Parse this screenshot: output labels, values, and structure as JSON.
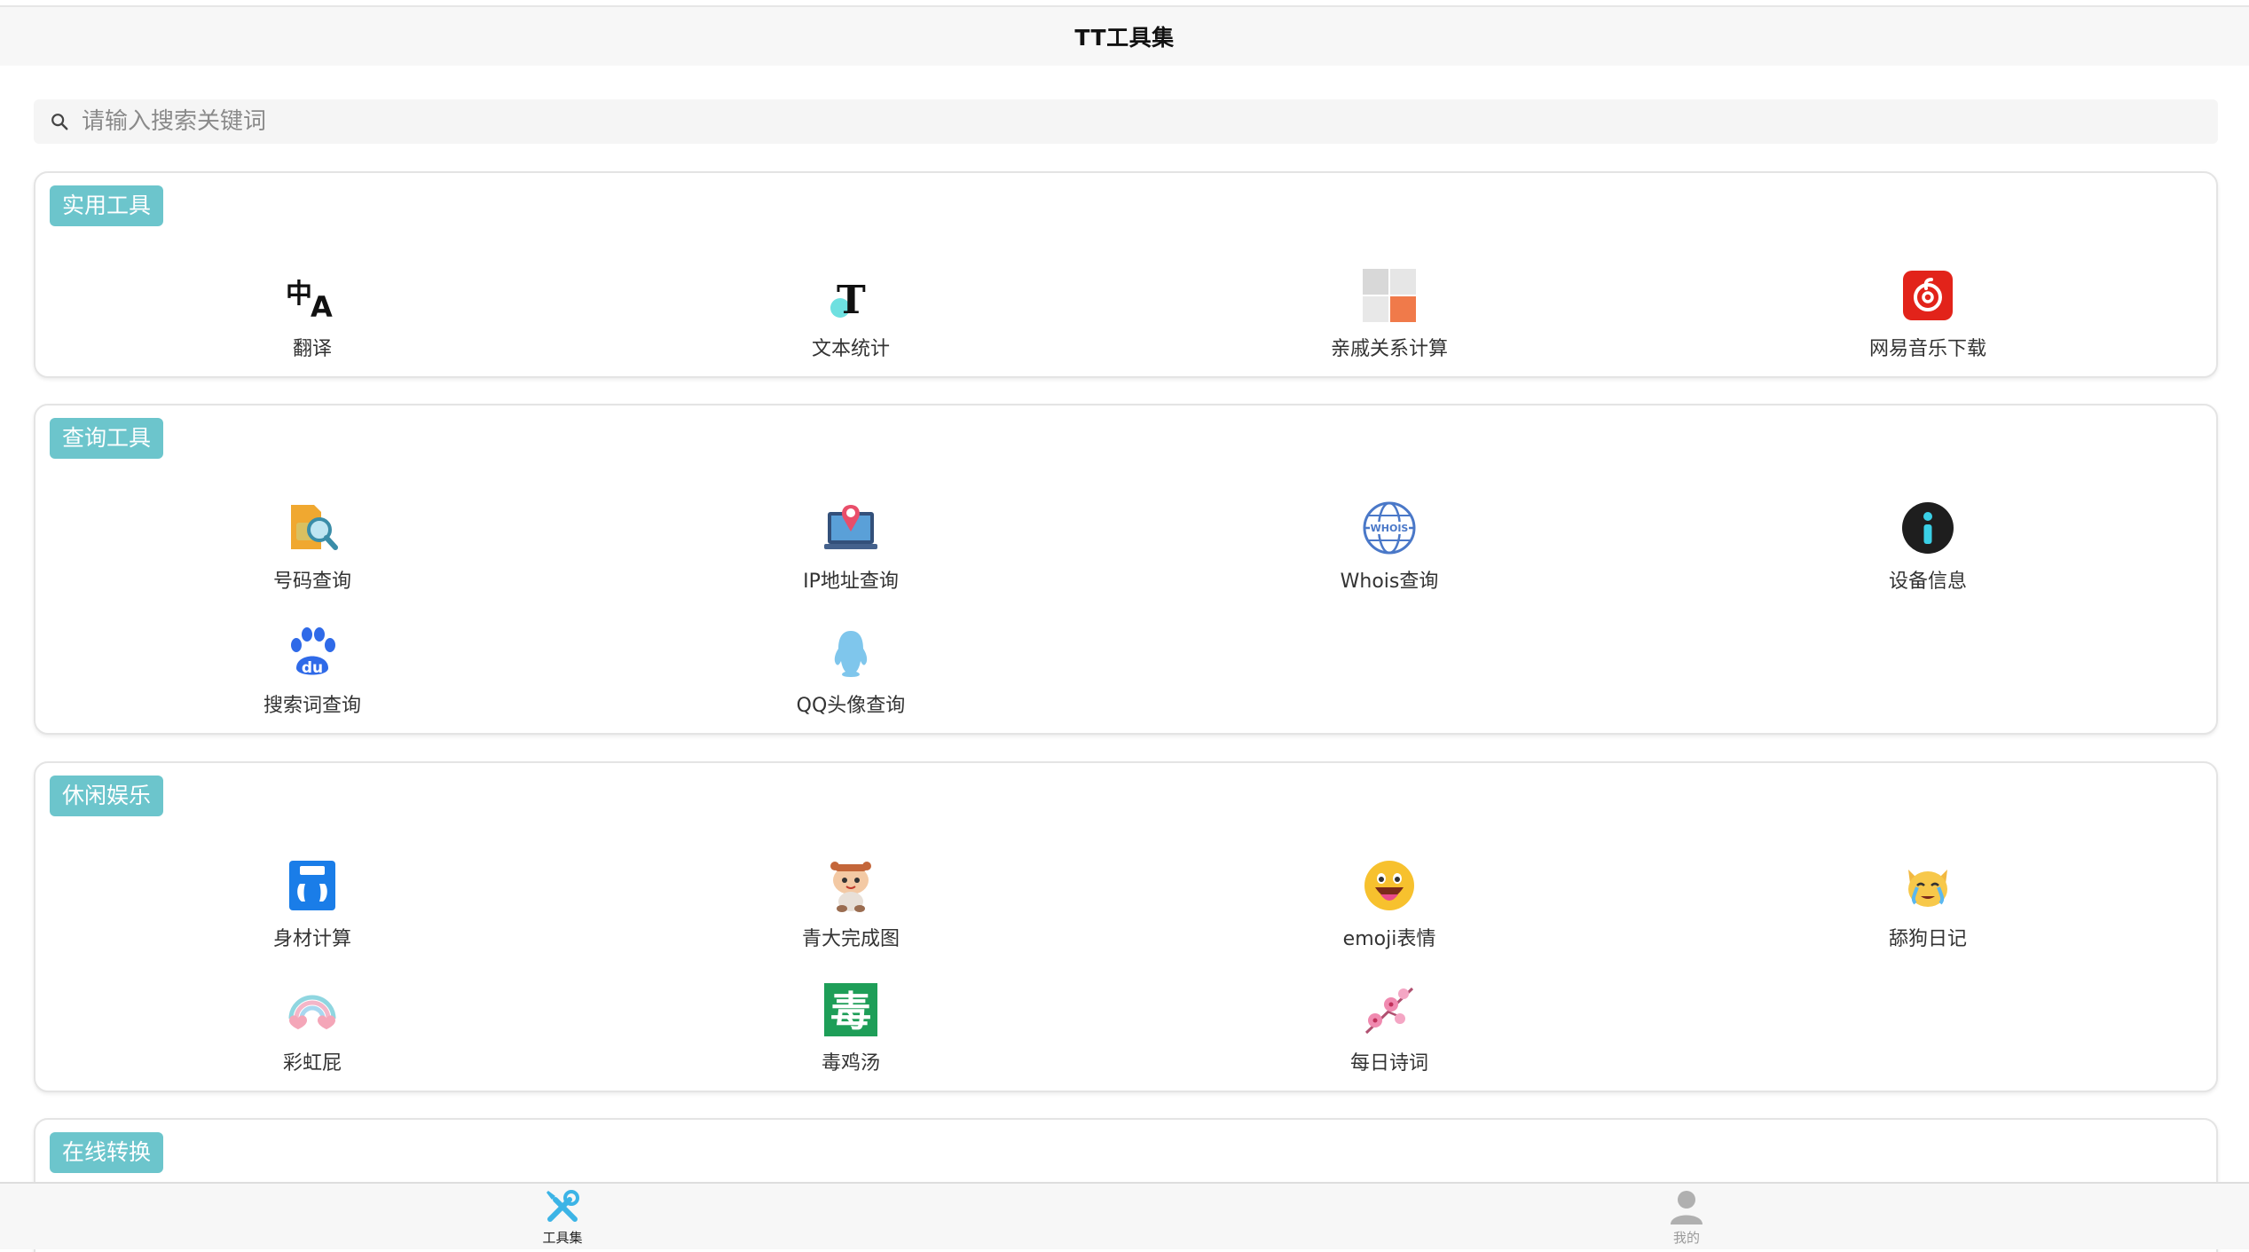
{
  "header": {
    "title": "TT工具集"
  },
  "search": {
    "placeholder": "请输入搜索关键词",
    "icon": "search-icon"
  },
  "sections": [
    {
      "title": "实用工具",
      "tools": [
        {
          "label": "翻译",
          "icon": "translate-icon"
        },
        {
          "label": "文本统计",
          "icon": "text-stats-icon"
        },
        {
          "label": "亲戚关系计算",
          "icon": "relatives-calc-icon"
        },
        {
          "label": "网易音乐下载",
          "icon": "netease-music-icon"
        }
      ]
    },
    {
      "title": "查询工具",
      "tools": [
        {
          "label": "号码查询",
          "icon": "phone-number-search-icon"
        },
        {
          "label": "IP地址查询",
          "icon": "ip-location-icon"
        },
        {
          "label": "Whois查询",
          "icon": "whois-globe-icon"
        },
        {
          "label": "设备信息",
          "icon": "device-info-icon"
        },
        {
          "label": "搜索词查询",
          "icon": "baidu-paw-icon"
        },
        {
          "label": "QQ头像查询",
          "icon": "qq-penguin-icon"
        }
      ]
    },
    {
      "title": "休闲娱乐",
      "tools": [
        {
          "label": "身材计算",
          "icon": "body-scale-icon"
        },
        {
          "label": "青大完成图",
          "icon": "cartoon-character-icon"
        },
        {
          "label": "emoji表情",
          "icon": "emoji-face-icon"
        },
        {
          "label": "舔狗日记",
          "icon": "crying-cat-icon"
        },
        {
          "label": "彩虹屁",
          "icon": "rainbow-icon"
        },
        {
          "label": "毒鸡汤",
          "icon": "poison-char-icon"
        },
        {
          "label": "每日诗词",
          "icon": "plum-blossom-icon"
        }
      ]
    },
    {
      "title": "在线转换",
      "tools": []
    }
  ],
  "tabbar": {
    "tabs": [
      {
        "label": "工具集",
        "icon": "wrench-screwdriver-icon",
        "active": true,
        "color": "#3cb4e6"
      },
      {
        "label": "我的",
        "icon": "user-icon",
        "active": false,
        "color": "#b0b0b0"
      }
    ]
  },
  "colors": {
    "accent_tag": "#6cc5cc",
    "active_tab": "#3cb4e6"
  }
}
